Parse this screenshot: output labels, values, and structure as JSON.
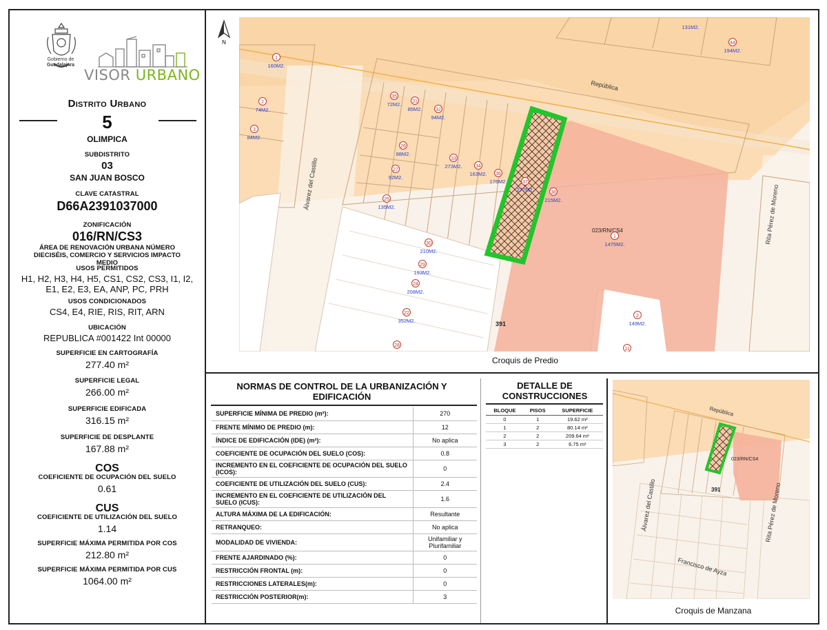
{
  "branding": {
    "seal_label_1": "Gobierno de",
    "seal_label_2": "Guadalajara",
    "visor_word": "VISOR",
    "urbano_word": "URBANO"
  },
  "distrito": {
    "title": "Distrito Urbano",
    "number": "5",
    "name": "OLIMPICA"
  },
  "subdistrito": {
    "label": "SUBDISTRITO",
    "number": "03",
    "name": "SAN JUAN BOSCO"
  },
  "clave": {
    "label": "CLAVE CATASTRAL",
    "value": "D66A2391037000"
  },
  "zonificacion": {
    "label": "ZONIFICACIÓN",
    "value": "016/RN/CS3",
    "description": "ÁREA DE RENOVACIÓN URBANA NÚMERO DIECISÉIS, COMERCIO Y SERVICIOS IMPACTO MEDIO"
  },
  "usos_permitidos": {
    "label": "USOS PERMITIDOS",
    "value": "H1, H2, H3, H4, H5, CS1, CS2, CS3, I1, I2, E1, E2, E3, EA, ANP, PC, PRH"
  },
  "usos_condicionados": {
    "label": "USOS CONDICIONADOS",
    "value": "CS4, E4, RIE, RIS, RIT, ARN"
  },
  "ubicacion": {
    "label": "UBICACIÓN",
    "value": "REPUBLICA #001422 Int 00000"
  },
  "sup_cartografia": {
    "label": "SUPERFICIE EN CARTOGRAFÍA",
    "value": "277.40 m²"
  },
  "sup_legal": {
    "label": "SUPERFICIE LEGAL",
    "value": "266.00 m²"
  },
  "sup_edificada": {
    "label": "SUPERFICIE EDIFICADA",
    "value": "316.15 m²"
  },
  "sup_desplante": {
    "label": "SUPERFICIE DE DESPLANTE",
    "value": "167.88 m²"
  },
  "cos": {
    "title": "COS",
    "label": "COEFICIENTE DE OCUPACIÓN DEL SUELO",
    "value": "0.61"
  },
  "cus": {
    "title": "CUS",
    "label": "COEFICIENTE DE UTILIZACIÓN DEL SUELO",
    "value": "1.14"
  },
  "sup_max_cos": {
    "label": "SUPERFICIE MÁXIMA PERMITIDA POR COS",
    "value": "212.80 m²"
  },
  "sup_max_cus": {
    "label": "SUPERFICIE MÁXIMA PERMITIDA POR CUS",
    "value": "1064.00 m²"
  },
  "map_main": {
    "north": "N",
    "caption": "Croquis de Predio",
    "street_republica": "República",
    "street_alvarez": "Álvarez del Castillo",
    "street_rita": "Rita Pérez de Moreno",
    "block_number": "391",
    "zone_label": "023/RN/CS4",
    "lots": [
      {
        "num": "1",
        "area": "160M2."
      },
      {
        "num": "2",
        "area": "74M2."
      },
      {
        "num": "3",
        "area": "84M2."
      },
      {
        "num": "35",
        "area": "72M2."
      },
      {
        "num": "31",
        "area": "85M2."
      },
      {
        "num": "32",
        "area": "94M2."
      },
      {
        "num": "26",
        "area": "88M2."
      },
      {
        "num": "27",
        "area": "92M2."
      },
      {
        "num": "25",
        "area": "135M2."
      },
      {
        "num": "33",
        "area": "273M2."
      },
      {
        "num": "34",
        "area": "163M2."
      },
      {
        "num": "36",
        "area": "176M2."
      },
      {
        "num": "37",
        "area": "277M2."
      },
      {
        "num": "38",
        "area": "215M2."
      },
      {
        "num": "1",
        "area": "1475M2."
      },
      {
        "num": "30",
        "area": "210M2."
      },
      {
        "num": "29",
        "area": "193M2."
      },
      {
        "num": "24",
        "area": "208M2."
      },
      {
        "num": "22",
        "area": "352M2."
      },
      {
        "num": "28",
        "area": ""
      },
      {
        "num": "2",
        "area": "149M2."
      },
      {
        "num": "11",
        "area": ""
      },
      {
        "num": "44",
        "area": "194M2."
      },
      {
        "num": "",
        "area": "131M2."
      }
    ]
  },
  "map_small": {
    "caption": "Croquis de Manzana",
    "street_republica": "República",
    "street_alvarez": "Álvarez del Castillo",
    "street_rita": "Rita Pérez de Moreno",
    "street_ayza": "Francisco de Ayza",
    "block_number": "391",
    "zone_label": "023/RN/CS4"
  },
  "normas": {
    "title": "NORMAS DE CONTROL DE LA URBANIZACIÓN Y EDIFICACIÓN",
    "rows": [
      {
        "key": "SUPERFICIE MÍNIMA DE PREDIO (m²):",
        "value": "270"
      },
      {
        "key": "FRENTE MÍNIMO DE PREDIO (m):",
        "value": "12"
      },
      {
        "key": "ÍNDICE DE EDIFICACIÓN (IDE) (m²):",
        "value": "No aplica"
      },
      {
        "key": "COEFICIENTE DE OCUPACIÓN DEL SUELO (COS):",
        "value": "0.8"
      },
      {
        "key": "INCREMENTO EN EL COEFICIENTE DE OCUPACIÓN DEL SUELO (ICOS):",
        "value": "0"
      },
      {
        "key": "COEFICIENTE DE UTILIZACIÓN DEL SUELO (CUS):",
        "value": "2.4"
      },
      {
        "key": "INCREMENTO EN EL COEFICIENTE DE UTILIZACIÓN DEL SUELO (ICUS):",
        "value": "1.6"
      },
      {
        "key": "ALTURA MÁXIMA DE LA EDIFICACIÓN:",
        "value": "Resultante"
      },
      {
        "key": "RETRANQUEO:",
        "value": "No aplica"
      },
      {
        "key": "MODALIDAD DE VIVIENDA:",
        "value": "Unifamiliar y Plurifamiliar"
      },
      {
        "key": "FRENTE AJARDINADO (%):",
        "value": "0"
      },
      {
        "key": "RESTRICCIÓN FRONTAL (m):",
        "value": "0"
      },
      {
        "key": "RESTRICCIONES LATERALES(m):",
        "value": "0"
      },
      {
        "key": "RESTRICCIÓN POSTERIOR(m):",
        "value": "3"
      }
    ]
  },
  "detalle": {
    "title": "DETALLE DE CONSTRUCCIONES",
    "headers": [
      "BLOQUE",
      "PISOS",
      "SUPERFICIE"
    ],
    "rows": [
      [
        "0",
        "1",
        "19.62 m²"
      ],
      [
        "1",
        "2",
        "80.14 m²"
      ],
      [
        "2",
        "2",
        "209.64 m²"
      ],
      [
        "3",
        "2",
        "6.75 m²"
      ]
    ]
  }
}
